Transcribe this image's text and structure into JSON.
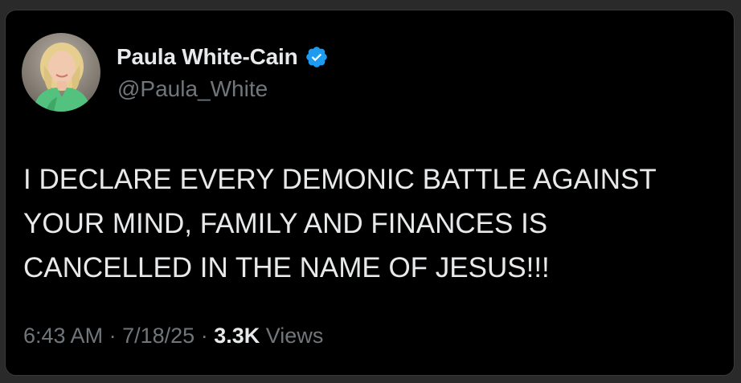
{
  "post": {
    "author": {
      "display_name": "Paula White-Cain",
      "handle": "@Paula_White",
      "verified_icon": "verified-badge-icon",
      "verified_color": "#1d9bf0"
    },
    "text": "I DECLARE EVERY DEMONIC BATTLE AGAINST\nYOUR MIND, FAMILY AND FINANCES IS\nCANCELLED IN THE NAME OF JESUS!!!",
    "time": "6:43 AM",
    "separator": "·",
    "date": "7/18/25",
    "views_count": "3.3K",
    "views_label": "Views"
  },
  "colors": {
    "background": "#000000",
    "text_primary": "#e7e9ea",
    "text_secondary": "#71767b"
  }
}
